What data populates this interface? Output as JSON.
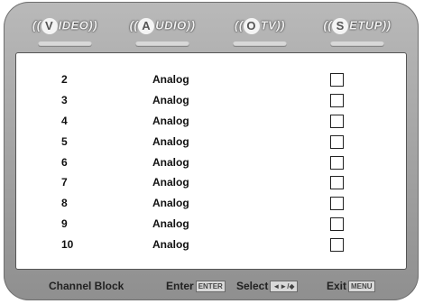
{
  "tabs": [
    {
      "letter": "V",
      "label": "IDEO"
    },
    {
      "letter": "A",
      "label": "UDIO"
    },
    {
      "letter": "O",
      "label": "TV"
    },
    {
      "letter": "S",
      "label": "ETUP"
    }
  ],
  "channels": [
    {
      "number": "2",
      "type": "Analog",
      "blocked": false
    },
    {
      "number": "3",
      "type": "Analog",
      "blocked": false
    },
    {
      "number": "4",
      "type": "Analog",
      "blocked": false
    },
    {
      "number": "5",
      "type": "Analog",
      "blocked": false
    },
    {
      "number": "6",
      "type": "Analog",
      "blocked": false
    },
    {
      "number": "7",
      "type": "Analog",
      "blocked": false
    },
    {
      "number": "8",
      "type": "Analog",
      "blocked": false
    },
    {
      "number": "9",
      "type": "Analog",
      "blocked": false
    },
    {
      "number": "10",
      "type": "Analog",
      "blocked": false
    }
  ],
  "footer": {
    "title": "Channel Block",
    "enter_label": "Enter",
    "enter_key": "ENTER",
    "select_label": "Select",
    "select_key": "◄►/◆",
    "exit_label": "Exit",
    "exit_key": "MENU"
  }
}
